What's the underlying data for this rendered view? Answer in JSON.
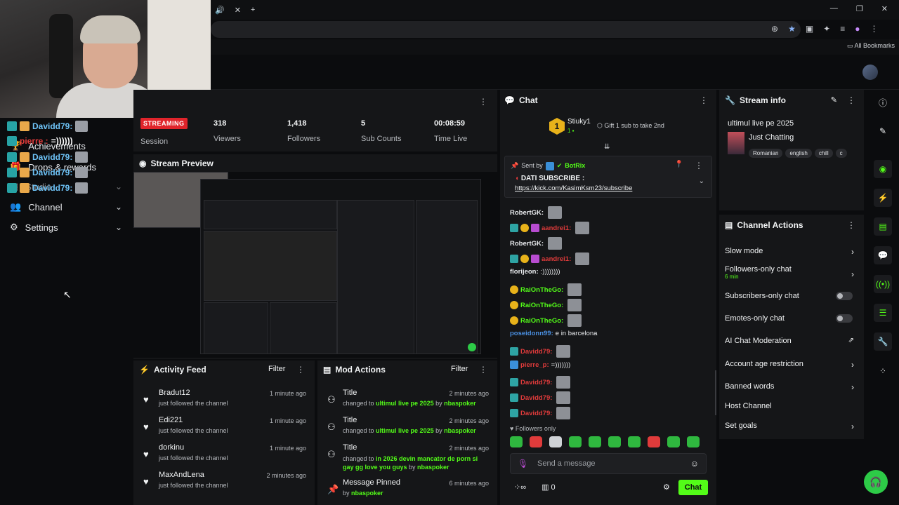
{
  "browser": {
    "tab_icons": [
      "🔊",
      "✕",
      "+"
    ],
    "window_controls": [
      "—",
      "❐",
      "✕"
    ],
    "all_bookmarks": "All Bookmarks"
  },
  "sidebar": {
    "overlay_users": [
      "Davidd79:",
      "pierre :",
      "Davidd79:",
      "Davidd79:",
      "Davidd79:"
    ],
    "overlay_msgs": [
      "",
      "=))))))",
      "",
      "",
      ""
    ],
    "items": [
      {
        "label": "Achievements",
        "icon": "trophy-icon"
      },
      {
        "label": "Drops & rewards",
        "icon": "gift-icon"
      },
      {
        "label": "Studio",
        "icon": "studio-icon"
      },
      {
        "label": "Channel",
        "icon": "users-icon"
      },
      {
        "label": "Settings",
        "icon": "gear-icon"
      }
    ]
  },
  "stats": {
    "status": "STREAMING",
    "session_label": "Session",
    "items": [
      {
        "value": "318",
        "label": "Viewers"
      },
      {
        "value": "1,418",
        "label": "Followers"
      },
      {
        "value": "5",
        "label": "Sub Counts"
      },
      {
        "value": "00:08:59",
        "label": "Time Live"
      }
    ]
  },
  "preview": {
    "title": "Stream Preview"
  },
  "activity": {
    "title": "Activity Feed",
    "filter": "Filter",
    "items": [
      {
        "name": "Bradut12",
        "sub": "just followed the channel",
        "time": "1 minute ago"
      },
      {
        "name": "Edi221",
        "sub": "just followed the channel",
        "time": "1 minute ago"
      },
      {
        "name": "dorkinu",
        "sub": "just followed the channel",
        "time": "1 minute ago"
      },
      {
        "name": "MaxAndLena",
        "sub": "just followed the channel",
        "time": "2 minutes ago"
      }
    ]
  },
  "mod": {
    "title": "Mod Actions",
    "filter": "Filter",
    "items": [
      {
        "title": "Title",
        "pre": "changed to ",
        "val": "ultimul live pe 2025",
        "by": " by ",
        "user": "nbaspoker",
        "time": "2 minutes ago"
      },
      {
        "title": "Title",
        "pre": "changed to ",
        "val": "ultimul live pe 2025",
        "by": " by ",
        "user": "nbaspoker",
        "time": "2 minutes ago"
      },
      {
        "title": "Title",
        "pre": "changed to ",
        "val": "in 2026 devin mancator de porn si gay gg love you guys",
        "by": " by ",
        "user": "nbaspoker",
        "time": "2 minutes ago"
      },
      {
        "title": "Message Pinned",
        "pre": "by ",
        "val": "",
        "by": "",
        "user": "nbaspoker",
        "time": "6 minutes ago"
      }
    ]
  },
  "chat": {
    "title": "Chat",
    "top_gifter": "Stiuky1",
    "top_gifter_count": "1",
    "gift_prompt": "Gift 1 sub to take 2nd",
    "pinned_sent_by": "Sent by",
    "pinned_user": "BotRix",
    "pinned_msg": "DATI SUBSCRIBE :",
    "pinned_link": "https://kick.com/KasimKsm23/subscribe",
    "messages": [
      {
        "user": "RobertGK:",
        "color": "#e8eaed",
        "text": ""
      },
      {
        "user": "aandrei1:",
        "color": "#e03b3b",
        "text": ""
      },
      {
        "user": "RobertGK:",
        "color": "#e8eaed",
        "text": ""
      },
      {
        "user": "aandrei1:",
        "color": "#e03b3b",
        "text": ""
      },
      {
        "user": "florijeon:",
        "color": "#e8eaed",
        "text": ":))))))))"
      },
      {
        "user": "RaiOnTheGo:",
        "color": "#53fc18",
        "text": ""
      },
      {
        "user": "RaiOnTheGo:",
        "color": "#53fc18",
        "text": ""
      },
      {
        "user": "RaiOnTheGo:",
        "color": "#53fc18",
        "text": ""
      },
      {
        "user": "poseidonn99:",
        "color": "#4a90e2",
        "text": "e in barcelona"
      },
      {
        "user": "Davidd79:",
        "color": "#e03b3b",
        "text": ""
      },
      {
        "user": "pierre_p:",
        "color": "#e03b3b",
        "text": "=)))))))"
      },
      {
        "user": "Davidd79:",
        "color": "#e03b3b",
        "text": ""
      },
      {
        "user": "Davidd79:",
        "color": "#e03b3b",
        "text": ""
      },
      {
        "user": "Davidd79:",
        "color": "#e03b3b",
        "text": ""
      }
    ],
    "followers_only": "Followers only",
    "input_placeholder": "Send a message",
    "counter": "0",
    "send_label": "Chat"
  },
  "streaminfo": {
    "title": "Stream info",
    "stream_title": "ultimul live pe 2025",
    "category": "Just Chatting",
    "tags": [
      "Romanian",
      "english",
      "chill",
      "c"
    ]
  },
  "channel_actions": {
    "title": "Channel Actions",
    "items": [
      {
        "label": "Slow mode",
        "sub": "",
        "control": "arrow"
      },
      {
        "label": "Followers-only chat",
        "sub": "6 min",
        "control": "arrow"
      },
      {
        "label": "Subscribers-only chat",
        "sub": "",
        "control": "toggle"
      },
      {
        "label": "Emotes-only chat",
        "sub": "",
        "control": "toggle"
      },
      {
        "label": "AI Chat Moderation",
        "sub": "",
        "control": "external"
      },
      {
        "label": "Account age restriction",
        "sub": "",
        "control": "arrow"
      },
      {
        "label": "Banned words",
        "sub": "",
        "control": "arrow"
      },
      {
        "label": "Host Channel",
        "sub": "",
        "control": "none"
      },
      {
        "label": "Set goals",
        "sub": "",
        "control": "arrow"
      }
    ]
  },
  "colors": {
    "accent": "#53fc18",
    "live": "#e0242b",
    "panel": "#151618"
  }
}
